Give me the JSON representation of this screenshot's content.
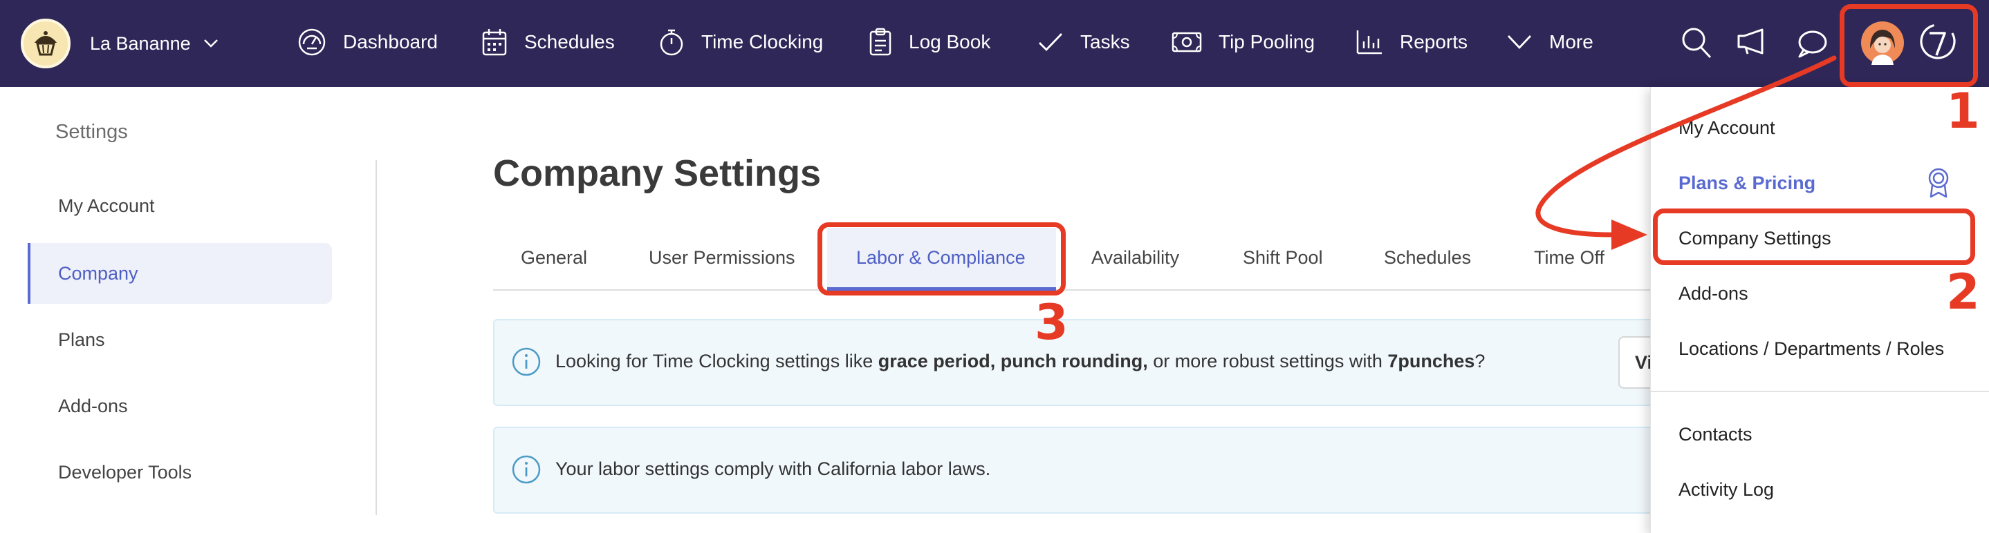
{
  "brand": {
    "name": "La Bananne"
  },
  "nav": {
    "items": [
      {
        "label": "Dashboard",
        "icon": "gauge-icon"
      },
      {
        "label": "Schedules",
        "icon": "calendar-icon"
      },
      {
        "label": "Time Clocking",
        "icon": "stopwatch-icon"
      },
      {
        "label": "Log Book",
        "icon": "clipboard-icon"
      },
      {
        "label": "Tasks",
        "icon": "checkmark-icon"
      },
      {
        "label": "Tip Pooling",
        "icon": "money-icon"
      },
      {
        "label": "Reports",
        "icon": "bar-chart-icon"
      },
      {
        "label": "More",
        "icon": "chevron-down-icon"
      }
    ]
  },
  "sidebar": {
    "title": "Settings",
    "items": [
      {
        "label": "My Account"
      },
      {
        "label": "Company"
      },
      {
        "label": "Plans"
      },
      {
        "label": "Add-ons"
      },
      {
        "label": "Developer Tools"
      }
    ]
  },
  "main": {
    "title": "Company Settings",
    "tabs": [
      {
        "label": "General"
      },
      {
        "label": "User Permissions"
      },
      {
        "label": "Labor & Compliance"
      },
      {
        "label": "Availability"
      },
      {
        "label": "Shift Pool"
      },
      {
        "label": "Schedules"
      },
      {
        "label": "Time Off"
      }
    ],
    "banner1": {
      "prefix": "Looking for Time Clocking settings like ",
      "bold1": "grace period, punch rounding,",
      "middle": " or more robust settings with ",
      "bold2": "7punches",
      "suffix": "?",
      "button": "Vi"
    },
    "banner2": {
      "text": "Your labor settings comply with California labor laws."
    }
  },
  "dropdown": {
    "items": [
      {
        "label": "My Account"
      },
      {
        "label": "Plans & Pricing"
      },
      {
        "label": "Company Settings"
      },
      {
        "label": "Add-ons"
      },
      {
        "label": "Locations / Departments / Roles"
      },
      {
        "label": "Contacts"
      },
      {
        "label": "Activity Log"
      }
    ]
  },
  "annotations": {
    "step1": "1",
    "step2": "2",
    "step3": "3"
  },
  "colors": {
    "nav_bg": "#2e2757",
    "accent": "#5a6ad0",
    "annotation": "#e63a25",
    "banner_bg": "#f1f8fc"
  }
}
